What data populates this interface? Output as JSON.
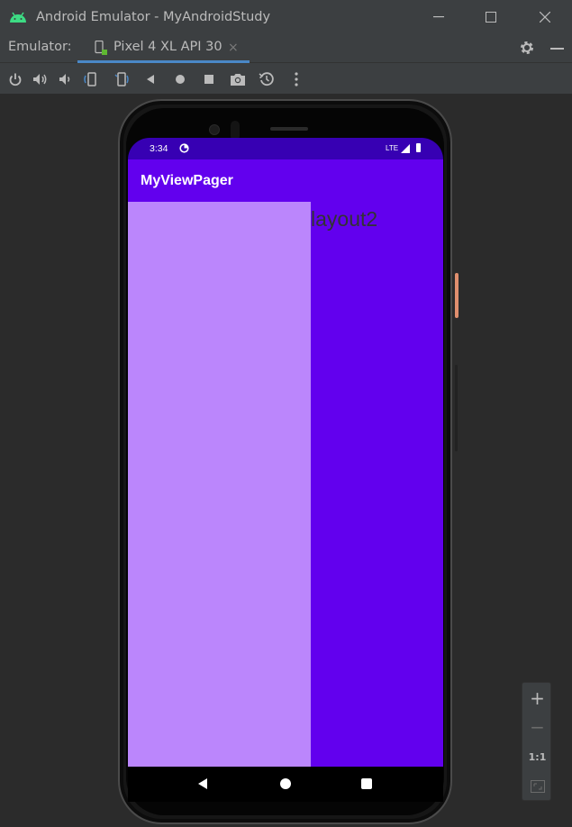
{
  "window": {
    "title": "Android Emulator - MyAndroidStudy",
    "controls": [
      "minimize-icon",
      "maximize-icon",
      "close-icon"
    ]
  },
  "tabbar": {
    "label": "Emulator:",
    "active_tab": "Pixel 4 XL API 30",
    "close_glyph": "×",
    "accent": "#4a88c7"
  },
  "toolbar": {
    "buttons": [
      "power-icon",
      "volume-up-icon",
      "volume-down-icon",
      "rotate-left-icon",
      "rotate-right-icon",
      "back-icon",
      "home-icon",
      "overview-icon",
      "screenshot-icon",
      "snapshot-icon",
      "more-icon"
    ]
  },
  "device": {
    "status": {
      "time": "3:34",
      "network": "LTE"
    },
    "app_title": "MyViewPager",
    "pages": [
      {
        "text": "",
        "color": "#bb86fc"
      },
      {
        "text": "layout2",
        "color": "#6200ee"
      }
    ],
    "colors": {
      "status_bar": "#3700b3",
      "app_bar": "#6200ee"
    }
  },
  "zoom": {
    "plus": "+",
    "minus": "−",
    "one_to_one": "1:1"
  }
}
